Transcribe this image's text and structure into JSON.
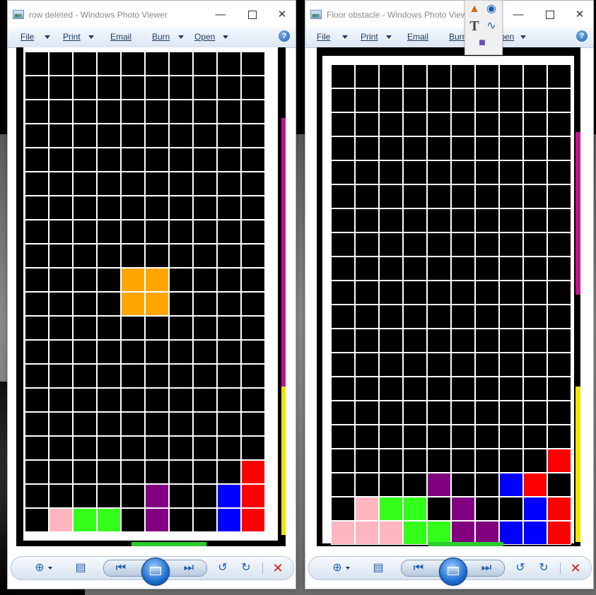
{
  "colors": {
    "empty": "#000000",
    "orange": "#ffa500",
    "pink": "#ffb6c1",
    "green": "#33ff1a",
    "purple": "#800080",
    "blue": "#0000ff",
    "red": "#ff0000"
  },
  "windows": [
    {
      "title": "row deleted - Windows Photo Viewer",
      "menu": [
        "File",
        "Print",
        "Email",
        "Burn",
        "Open"
      ],
      "board": [
        "..........",
        "..........",
        "..........",
        "..........",
        "..........",
        "..........",
        "..........",
        "..........",
        "..........",
        "....OO....",
        "....OO....",
        "..........",
        "..........",
        "..........",
        "..........",
        "..........",
        "..........",
        ".........R",
        ".....P..BR",
        ".KGG.P..BR"
      ]
    },
    {
      "title": "Floor obstacle - Windows Photo Viewer",
      "menu": [
        "File",
        "Print",
        "Email",
        "Burn",
        "Open"
      ],
      "board": [
        "..........",
        "..........",
        "..........",
        "..........",
        "..........",
        "..........",
        "..........",
        "..........",
        "..........",
        "..........",
        "..........",
        "..........",
        "..........",
        "..........",
        "..........",
        "..........",
        ".........R",
        "....P..BR",
        ".KGG.P..BR",
        "KKKGGPPBBR"
      ]
    }
  ],
  "toolbar": {
    "zoom": "zoom-icon",
    "fit": "actual-size-icon",
    "previous": "previous-icon",
    "slideshow": "slideshow-icon",
    "next": "next-icon",
    "rotate_ccw": "rotate-counterclockwise-icon",
    "rotate_cw": "rotate-clockwise-icon",
    "delete": "delete-icon"
  },
  "palette": [
    "stamp-icon",
    "paint-icon",
    "text-icon",
    "curve-icon",
    "shapes-icon"
  ]
}
